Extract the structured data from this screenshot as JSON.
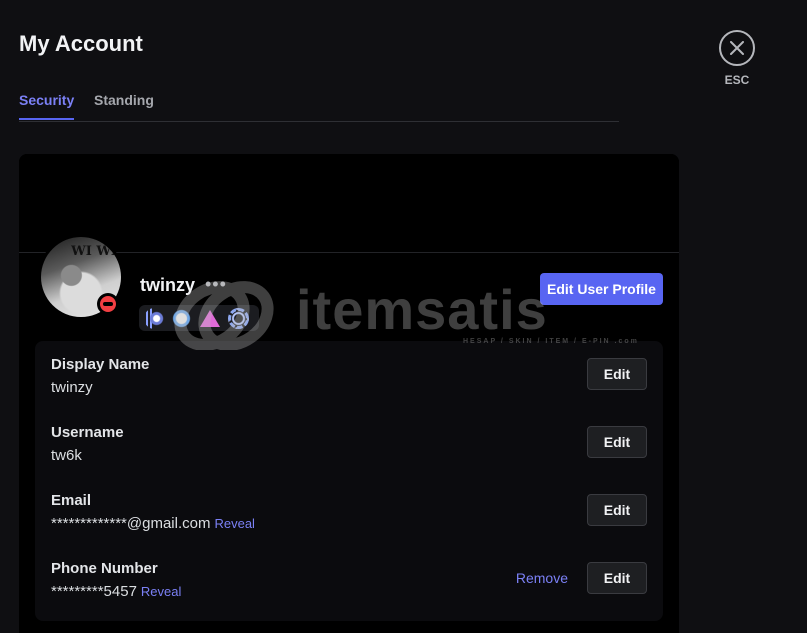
{
  "page": {
    "title": "My Account"
  },
  "tabs": [
    {
      "label": "Security",
      "active": true
    },
    {
      "label": "Standing",
      "active": false
    }
  ],
  "close": {
    "label": "ESC",
    "icon": "close-icon"
  },
  "profile": {
    "username": "twinzy",
    "status": "do-not-disturb",
    "avatar_text": "WI WI",
    "edit_profile_label": "Edit User Profile",
    "badges": [
      "hypesquad-badge",
      "quest-badge",
      "nitro-badge",
      "boost-badge"
    ]
  },
  "fields": [
    {
      "label": "Display Name",
      "value": "twinzy",
      "edit_label": "Edit"
    },
    {
      "label": "Username",
      "value": "tw6k",
      "edit_label": "Edit"
    },
    {
      "label": "Email",
      "value": "*************@gmail.com",
      "reveal_label": "Reveal",
      "edit_label": "Edit"
    },
    {
      "label": "Phone Number",
      "value": "*********5457",
      "reveal_label": "Reveal",
      "remove_label": "Remove",
      "edit_label": "Edit"
    }
  ],
  "watermark": {
    "text": "itemsatis",
    "subtext": "HESAP / SKIN / ITEM / E-PIN .com"
  },
  "colors": {
    "accent": "#5865f2",
    "link": "#7b80f5",
    "dnd": "#f23f43",
    "background": "#0f0f12"
  }
}
